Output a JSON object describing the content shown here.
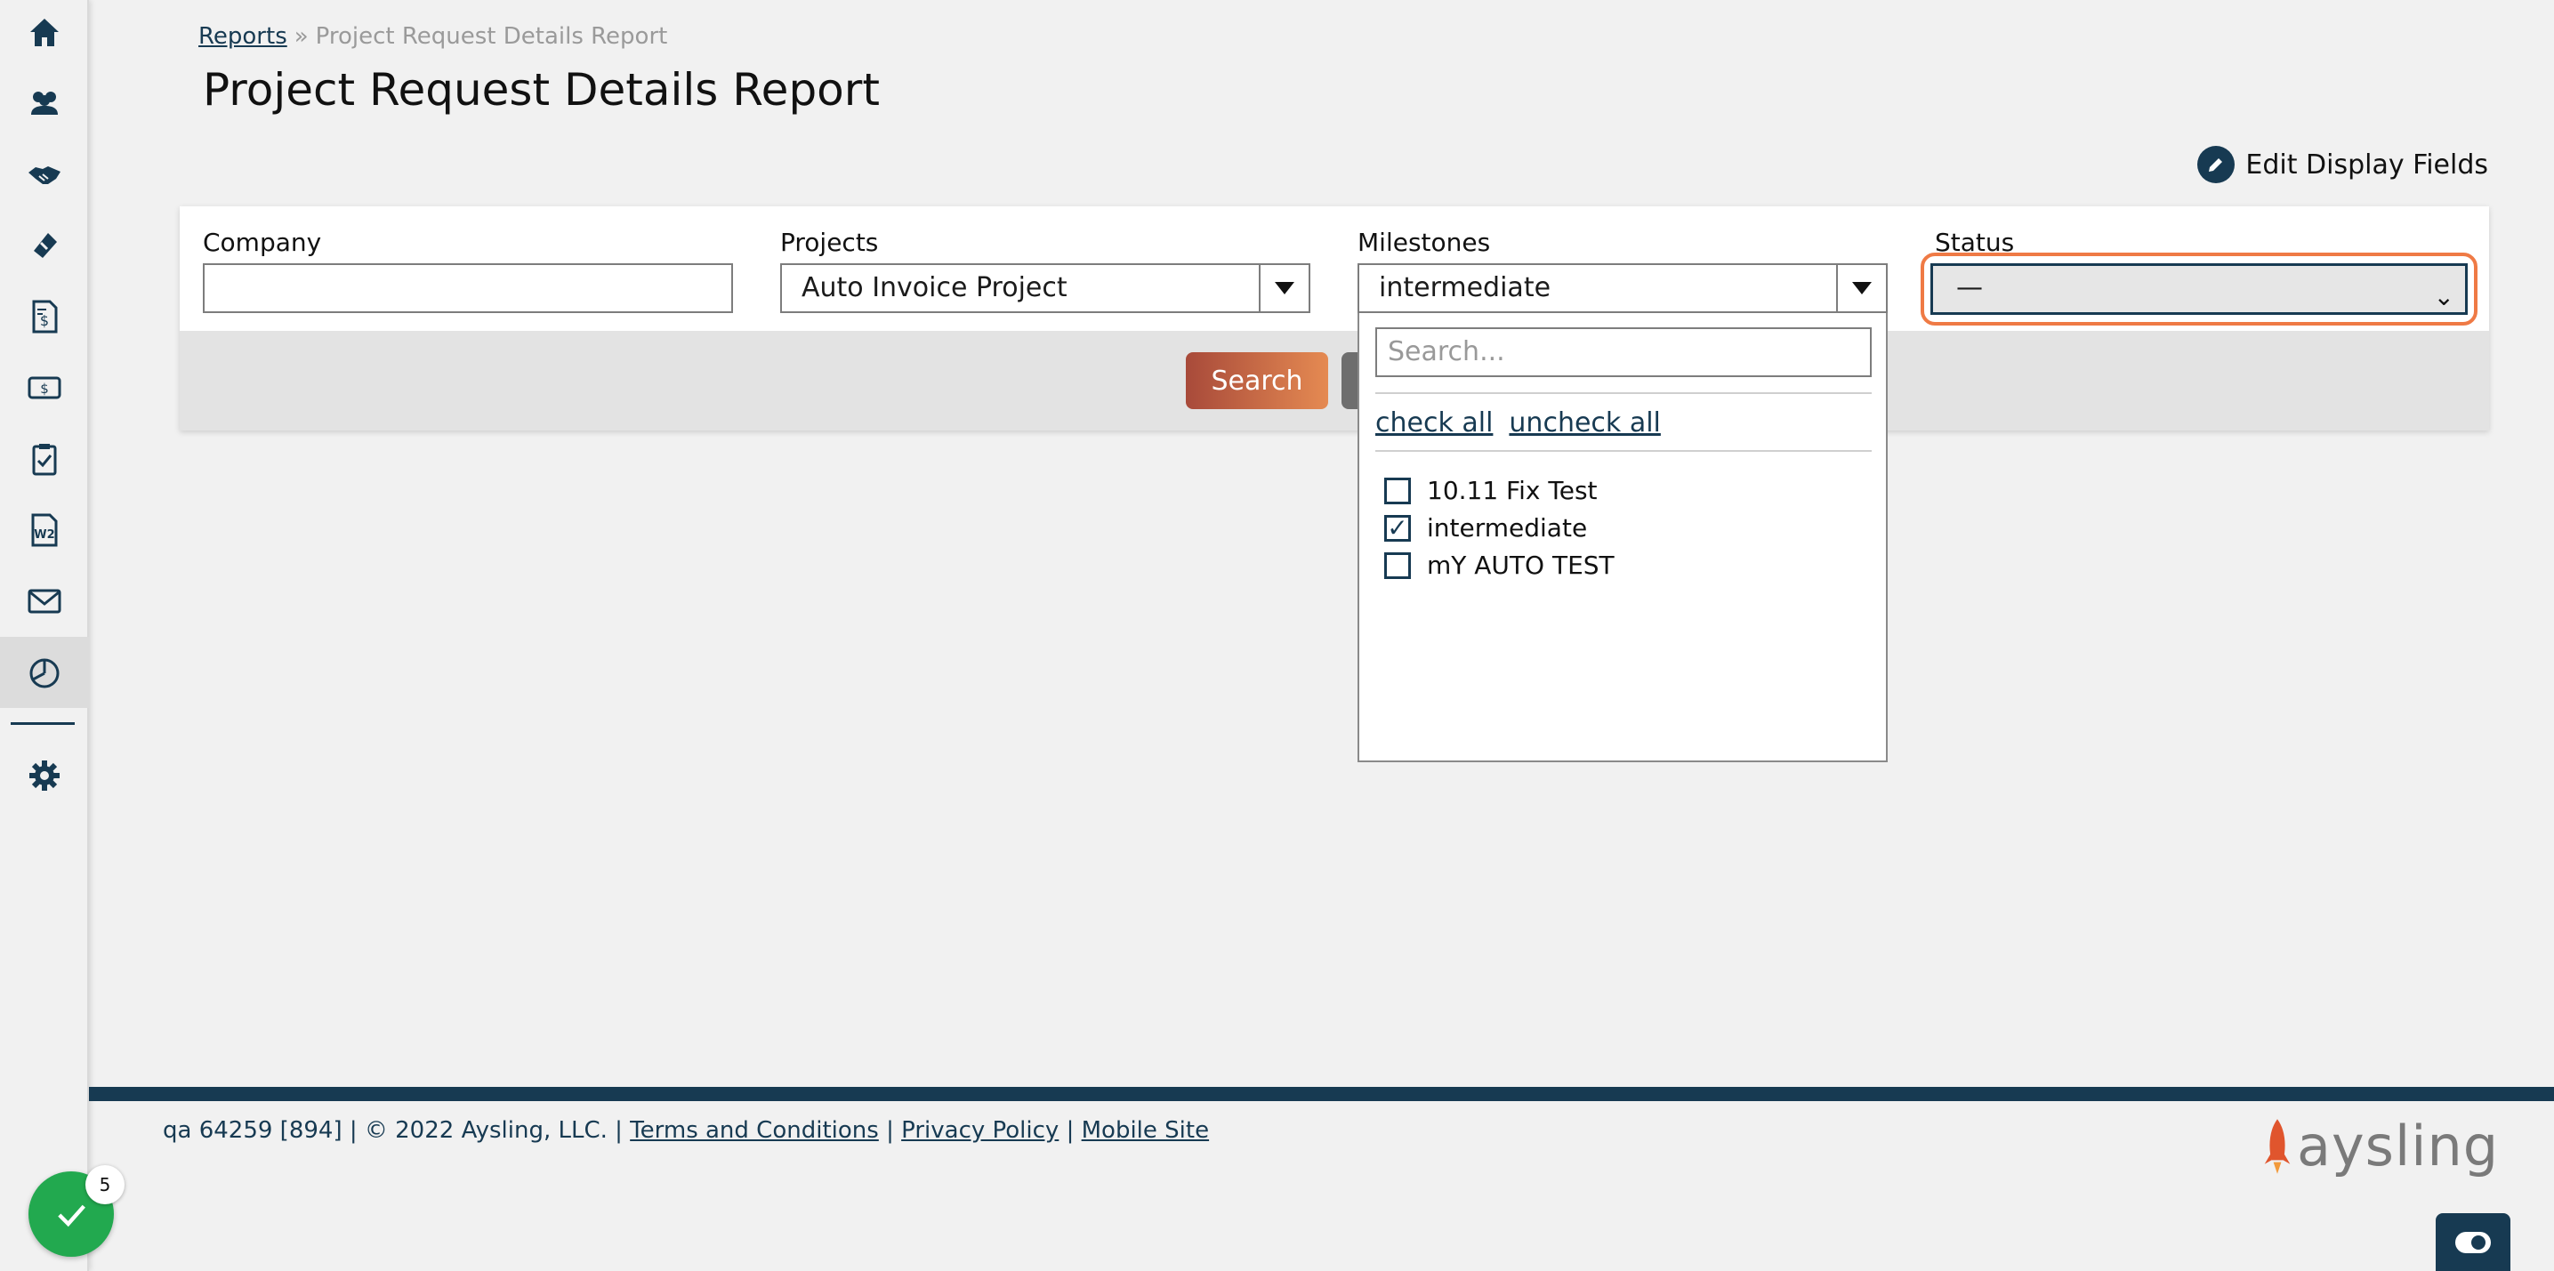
{
  "breadcrumb": {
    "root": "Reports",
    "separator": "»",
    "current": "Project Request Details Report"
  },
  "page": {
    "title": "Project Request Details Report",
    "edit_display_fields": "Edit Display Fields"
  },
  "filters": {
    "company": {
      "label": "Company",
      "value": ""
    },
    "projects": {
      "label": "Projects",
      "value": "Auto Invoice Project"
    },
    "milestones": {
      "label": "Milestones",
      "value": "intermediate"
    },
    "status": {
      "label": "Status",
      "value": "—"
    }
  },
  "actions": {
    "search_label": "Search"
  },
  "milestones_dropdown": {
    "search_placeholder": "Search...",
    "check_all": "check all",
    "uncheck_all": "uncheck all",
    "options": [
      {
        "label": "10.11 Fix Test",
        "checked": false
      },
      {
        "label": "intermediate",
        "checked": true
      },
      {
        "label": "mY AUTO TEST",
        "checked": false
      }
    ]
  },
  "footer": {
    "info": "qa 64259 [894] | © 2022 Aysling, LLC. |",
    "terms": "Terms and Conditions",
    "sep1": "|",
    "privacy": "Privacy Policy",
    "sep2": "|",
    "mobile": "Mobile Site",
    "logo_text": "aysling"
  },
  "fab": {
    "badge_count": "5"
  },
  "colors": {
    "navy": "#173a52",
    "accent_orange": "#ef7a45",
    "success_green": "#22a94f"
  },
  "sidebar": {
    "icons": [
      "home-icon",
      "users-icon",
      "handshake-icon",
      "ticket-icon",
      "invoice-icon",
      "billing-icon",
      "clipboard-check-icon",
      "w2-form-icon",
      "mail-icon",
      "reports-chart-icon",
      "settings-gear-icon"
    ]
  }
}
